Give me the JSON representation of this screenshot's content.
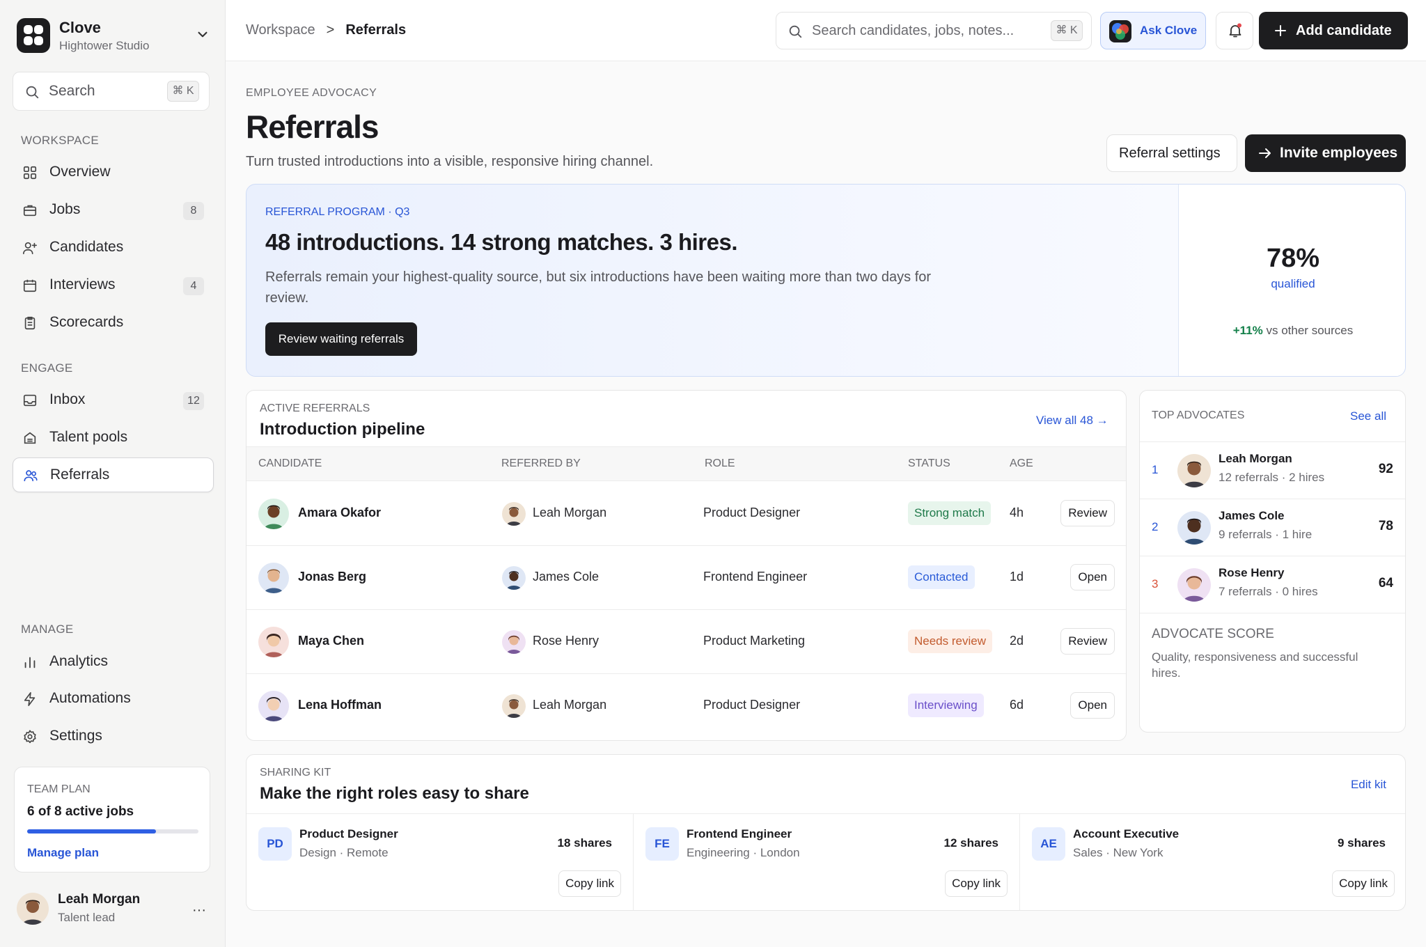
{
  "org": {
    "name": "Clove",
    "workspace": "Hightower Studio"
  },
  "sidebar": {
    "search": {
      "placeholder": "Search",
      "shortcut": "⌘ K"
    },
    "sections": {
      "workspace": "WORKSPACE",
      "engage": "ENGAGE",
      "manage": "MANAGE"
    },
    "items": [
      {
        "label": "Overview",
        "icon": "grid-icon"
      },
      {
        "label": "Jobs",
        "icon": "briefcase-icon",
        "badge": "8"
      },
      {
        "label": "Candidates",
        "icon": "user-plus-icon"
      },
      {
        "label": "Interviews",
        "icon": "calendar-icon",
        "badge": "4"
      },
      {
        "label": "Scorecards",
        "icon": "clipboard-icon"
      },
      {
        "label": "Inbox",
        "icon": "inbox-icon",
        "badge": "12"
      },
      {
        "label": "Talent pools",
        "icon": "archive-icon"
      },
      {
        "label": "Referrals",
        "icon": "users-icon",
        "active": true
      },
      {
        "label": "Analytics",
        "icon": "bar-chart-icon"
      },
      {
        "label": "Automations",
        "icon": "bolt-icon"
      },
      {
        "label": "Settings",
        "icon": "gear-icon"
      }
    ],
    "plan": {
      "label": "TEAM PLAN",
      "usage": "6 of 8 active jobs",
      "progress": 0.75,
      "link": "Manage plan"
    },
    "user": {
      "name": "Leah Morgan",
      "role": "Talent lead",
      "more": "···"
    }
  },
  "topbar": {
    "breadcrumb": {
      "parent": "Workspace",
      "separator": ">",
      "current": "Referrals"
    },
    "search": {
      "placeholder": "Search candidates, jobs, notes...",
      "shortcut": "⌘ K"
    },
    "ask": "Ask Clove",
    "add_candidate": "Add candidate"
  },
  "page": {
    "eyebrow": "EMPLOYEE ADVOCACY",
    "title": "Referrals",
    "subtitle": "Turn trusted introductions into a visible, responsive hiring channel.",
    "settings_button": "Referral settings",
    "invite_button": "Invite employees"
  },
  "hero": {
    "kicker": "REFERRAL PROGRAM · Q3",
    "headline": "48 introductions. 14 strong matches. 3 hires.",
    "body": "Referrals remain your highest-quality source, but six introductions have been waiting more than two days for review.",
    "cta": "Review waiting referrals",
    "stat": "78%",
    "stat_label": "qualified",
    "delta": "+11%",
    "delta_label": "vs other sources"
  },
  "pipeline": {
    "eyebrow": "ACTIVE REFERRALS",
    "title": "Introduction pipeline",
    "view_all": "View all 48 →",
    "columns": [
      "CANDIDATE",
      "REFERRED BY",
      "ROLE",
      "STATUS",
      "AGE"
    ],
    "rows": [
      {
        "candidate": "Amara Okafor",
        "referrer": "Leah Morgan",
        "role": "Product Designer",
        "status": "Strong match",
        "status_color": "#1f7a4a",
        "status_bg": "#e7f5ec",
        "age": "4h",
        "action": "Review"
      },
      {
        "candidate": "Jonas Berg",
        "referrer": "James Cole",
        "role": "Frontend Engineer",
        "status": "Contacted",
        "status_color": "#2a5bd7",
        "status_bg": "#e8efff",
        "age": "1d",
        "action": "Open"
      },
      {
        "candidate": "Maya Chen",
        "referrer": "Rose Henry",
        "role": "Product Marketing",
        "status": "Needs review",
        "status_color": "#c25b2e",
        "status_bg": "#fdeee6",
        "age": "2d",
        "action": "Review"
      },
      {
        "candidate": "Lena Hoffman",
        "referrer": "Leah Morgan",
        "role": "Product Designer",
        "status": "Interviewing",
        "status_color": "#6a4fc9",
        "status_bg": "#efeaff",
        "age": "6d",
        "action": "Open"
      }
    ]
  },
  "advocates": {
    "eyebrow": "TOP ADVOCATES",
    "see_all": "See all",
    "items": [
      {
        "rank": "1",
        "rank_color": "#2855d6",
        "name": "Leah Morgan",
        "meta": "12 referrals · 2 hires",
        "score": "92"
      },
      {
        "rank": "2",
        "rank_color": "#2855d6",
        "name": "James Cole",
        "meta": "9 referrals · 1 hire",
        "score": "78"
      },
      {
        "rank": "3",
        "rank_color": "#d9533a",
        "name": "Rose Henry",
        "meta": "7 referrals · 0 hires",
        "score": "64"
      }
    ],
    "score_title": "ADVOCATE SCORE",
    "score_desc": "Quality, responsiveness and successful hires."
  },
  "kit": {
    "eyebrow": "SHARING KIT",
    "title": "Make the right roles easy to share",
    "edit": "Edit kit",
    "items": [
      {
        "mono": "PD",
        "role": "Product Designer",
        "meta": "Design · Remote",
        "shares": "18 shares",
        "copy": "Copy link"
      },
      {
        "mono": "FE",
        "role": "Frontend Engineer",
        "meta": "Engineering · London",
        "shares": "12 shares",
        "copy": "Copy link"
      },
      {
        "mono": "AE",
        "role": "Account Executive",
        "meta": "Sales · New York",
        "shares": "9 shares",
        "copy": "Copy link"
      }
    ]
  },
  "colors": {
    "accent": "#2855d6",
    "dark": "#1d1d1f",
    "positive": "#14804a"
  }
}
